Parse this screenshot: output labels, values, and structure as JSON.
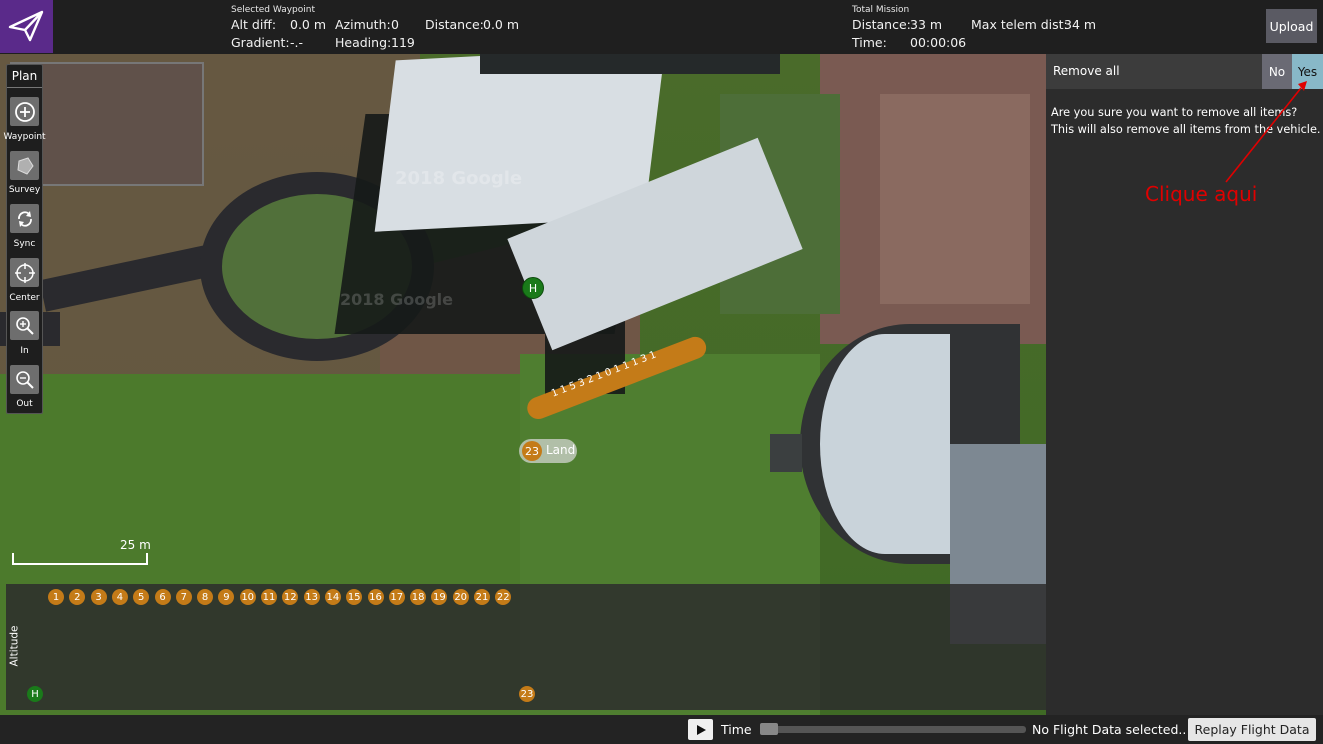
{
  "topbar": {
    "selected_waypoint_title": "Selected Waypoint",
    "alt_diff_label": "Alt diff:",
    "alt_diff_value": "0.0 m",
    "azimuth_label": "Azimuth:",
    "azimuth_value": "0",
    "distance_label": "Distance:",
    "distance_value": "0.0 m",
    "gradient_label": "Gradient:",
    "gradient_value": "-.-",
    "heading_label": "Heading:",
    "heading_value": "119",
    "total_mission_title": "Total Mission",
    "total_distance_label": "Distance:",
    "total_distance_value": "33 m",
    "max_telem_label": "Max telem dist:",
    "max_telem_value": "34 m",
    "time_label": "Time:",
    "time_value": "00:00:06",
    "upload_label": "Upload"
  },
  "toolstrip": {
    "title": "Plan",
    "tools": [
      {
        "label": "Waypoint",
        "icon": "plus-circle-icon"
      },
      {
        "label": "Survey",
        "icon": "polygon-icon"
      },
      {
        "label": "Sync",
        "icon": "sync-icon"
      },
      {
        "label": "Center",
        "icon": "crosshair-icon"
      },
      {
        "label": "In",
        "icon": "zoom-in-icon"
      },
      {
        "label": "Out",
        "icon": "zoom-out-icon"
      }
    ]
  },
  "map": {
    "watermark": "2018 Google",
    "home_marker": "H",
    "land_marker_number": "23",
    "land_marker_label": "Land",
    "path_labels": "1 1 5 3 2 1 0 1 1 1 3 1",
    "scale_label": "25 m"
  },
  "rightpanel": {
    "remove_all_label": "Remove all",
    "no_label": "No",
    "yes_label": "Yes",
    "confirm_message": "Are you sure you want to remove all items? This will also remove all items from the vehicle.",
    "annotation_text": "Clique aqui",
    "annotation_color": "#e00000"
  },
  "altitude": {
    "axis_label": "Altitude",
    "waypoints": [
      "1",
      "2",
      "3",
      "4",
      "5",
      "6",
      "7",
      "8",
      "9",
      "10",
      "11",
      "12",
      "13",
      "14",
      "15",
      "16",
      "17",
      "18",
      "19",
      "20",
      "21",
      "22"
    ],
    "home_label": "H",
    "land_number": "23"
  },
  "bottombar": {
    "time_label": "Time",
    "no_flight_label": "No Flight Data selected..",
    "replay_label": "Replay Flight Data"
  },
  "colors": {
    "waypoint": "#c47b18",
    "home": "#1a7a1a",
    "logo_bg": "#5a2a8a",
    "yes_button": "#88b8c8"
  }
}
